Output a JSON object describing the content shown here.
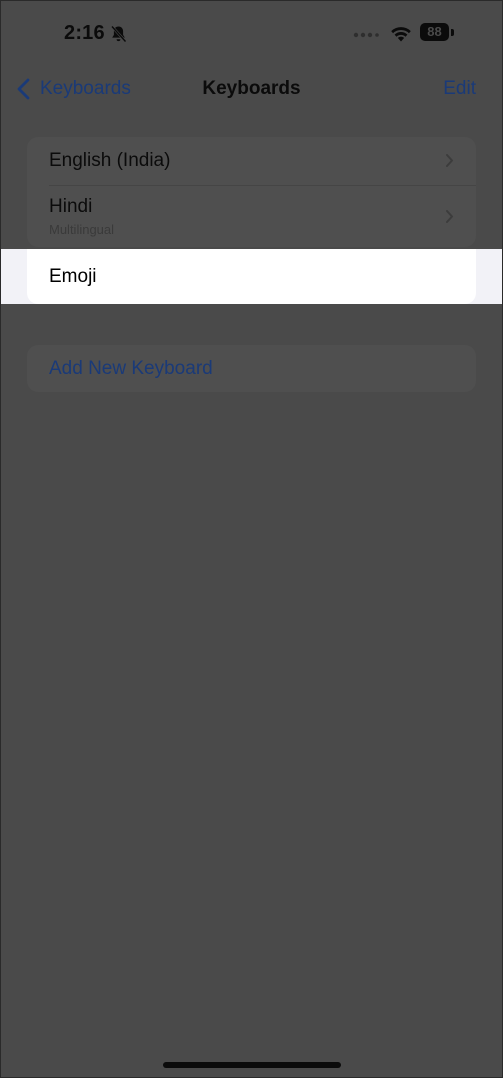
{
  "status_bar": {
    "time": "2:16",
    "battery_level": "88",
    "icons": [
      "bell-slash-icon",
      "cellular-signal-icon",
      "wifi-icon",
      "battery-icon"
    ]
  },
  "nav": {
    "back_label": "Keyboards",
    "title": "Keyboards",
    "edit_label": "Edit"
  },
  "keyboards": [
    {
      "label": "English (India)",
      "subtitle": ""
    },
    {
      "label": "Hindi",
      "subtitle": "Multilingual"
    },
    {
      "label": "Emoji",
      "subtitle": ""
    }
  ],
  "add_keyboard_label": "Add New Keyboard",
  "colors": {
    "accent": "#1a3a78",
    "dim_background": "#4a4a4a",
    "highlight_row": "#ffffff"
  }
}
